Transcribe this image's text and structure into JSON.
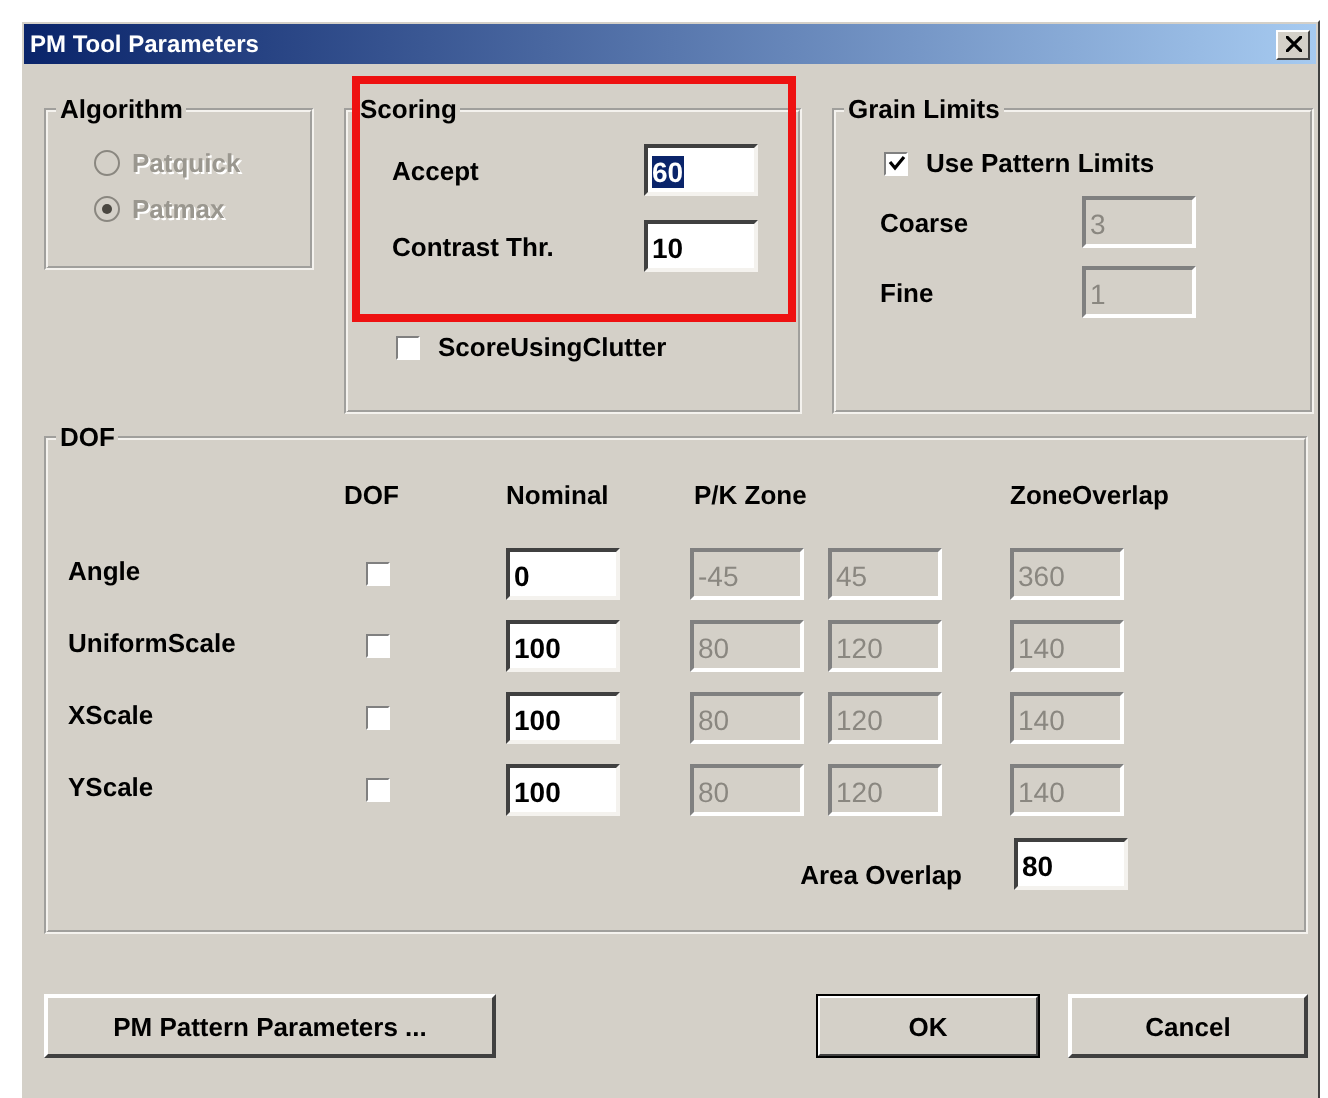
{
  "window": {
    "title": "PM Tool Parameters"
  },
  "algorithm": {
    "title": "Algorithm",
    "disabled": true,
    "options": [
      {
        "label": "Patquick",
        "selected": false
      },
      {
        "label": "Patmax",
        "selected": true
      }
    ]
  },
  "scoring": {
    "title": "Scoring",
    "highlighted": true,
    "fields": [
      {
        "label": "Accept",
        "value": "60",
        "text_selected": true
      },
      {
        "label": "Contrast Thr.",
        "value": "10",
        "text_selected": false
      }
    ],
    "clutter": {
      "label": "ScoreUsingClutter",
      "checked": false
    }
  },
  "grain_limits": {
    "title": "Grain Limits",
    "use_pattern_limits": {
      "label": "Use Pattern Limits",
      "checked": true
    },
    "fields": [
      {
        "label": "Coarse",
        "value": "3",
        "disabled": true
      },
      {
        "label": "Fine",
        "value": "1",
        "disabled": true
      }
    ]
  },
  "dof": {
    "title": "DOF",
    "columns": [
      "DOF",
      "Nominal",
      "P/K Zone",
      "ZoneOverlap"
    ],
    "rows": [
      {
        "label": "Angle",
        "checked": false,
        "nominal": "0",
        "zone_low": "-45",
        "zone_high": "45",
        "overlap": "360"
      },
      {
        "label": "UniformScale",
        "checked": false,
        "nominal": "100",
        "zone_low": "80",
        "zone_high": "120",
        "overlap": "140"
      },
      {
        "label": "XScale",
        "checked": false,
        "nominal": "100",
        "zone_low": "80",
        "zone_high": "120",
        "overlap": "140"
      },
      {
        "label": "YScale",
        "checked": false,
        "nominal": "100",
        "zone_low": "80",
        "zone_high": "120",
        "overlap": "140"
      }
    ],
    "area_overlap": {
      "label": "Area Overlap",
      "value": "80"
    }
  },
  "buttons": [
    {
      "label": "PM Pattern Parameters ...",
      "default": false
    },
    {
      "label": "OK",
      "default": true
    },
    {
      "label": "Cancel",
      "default": false
    }
  ]
}
